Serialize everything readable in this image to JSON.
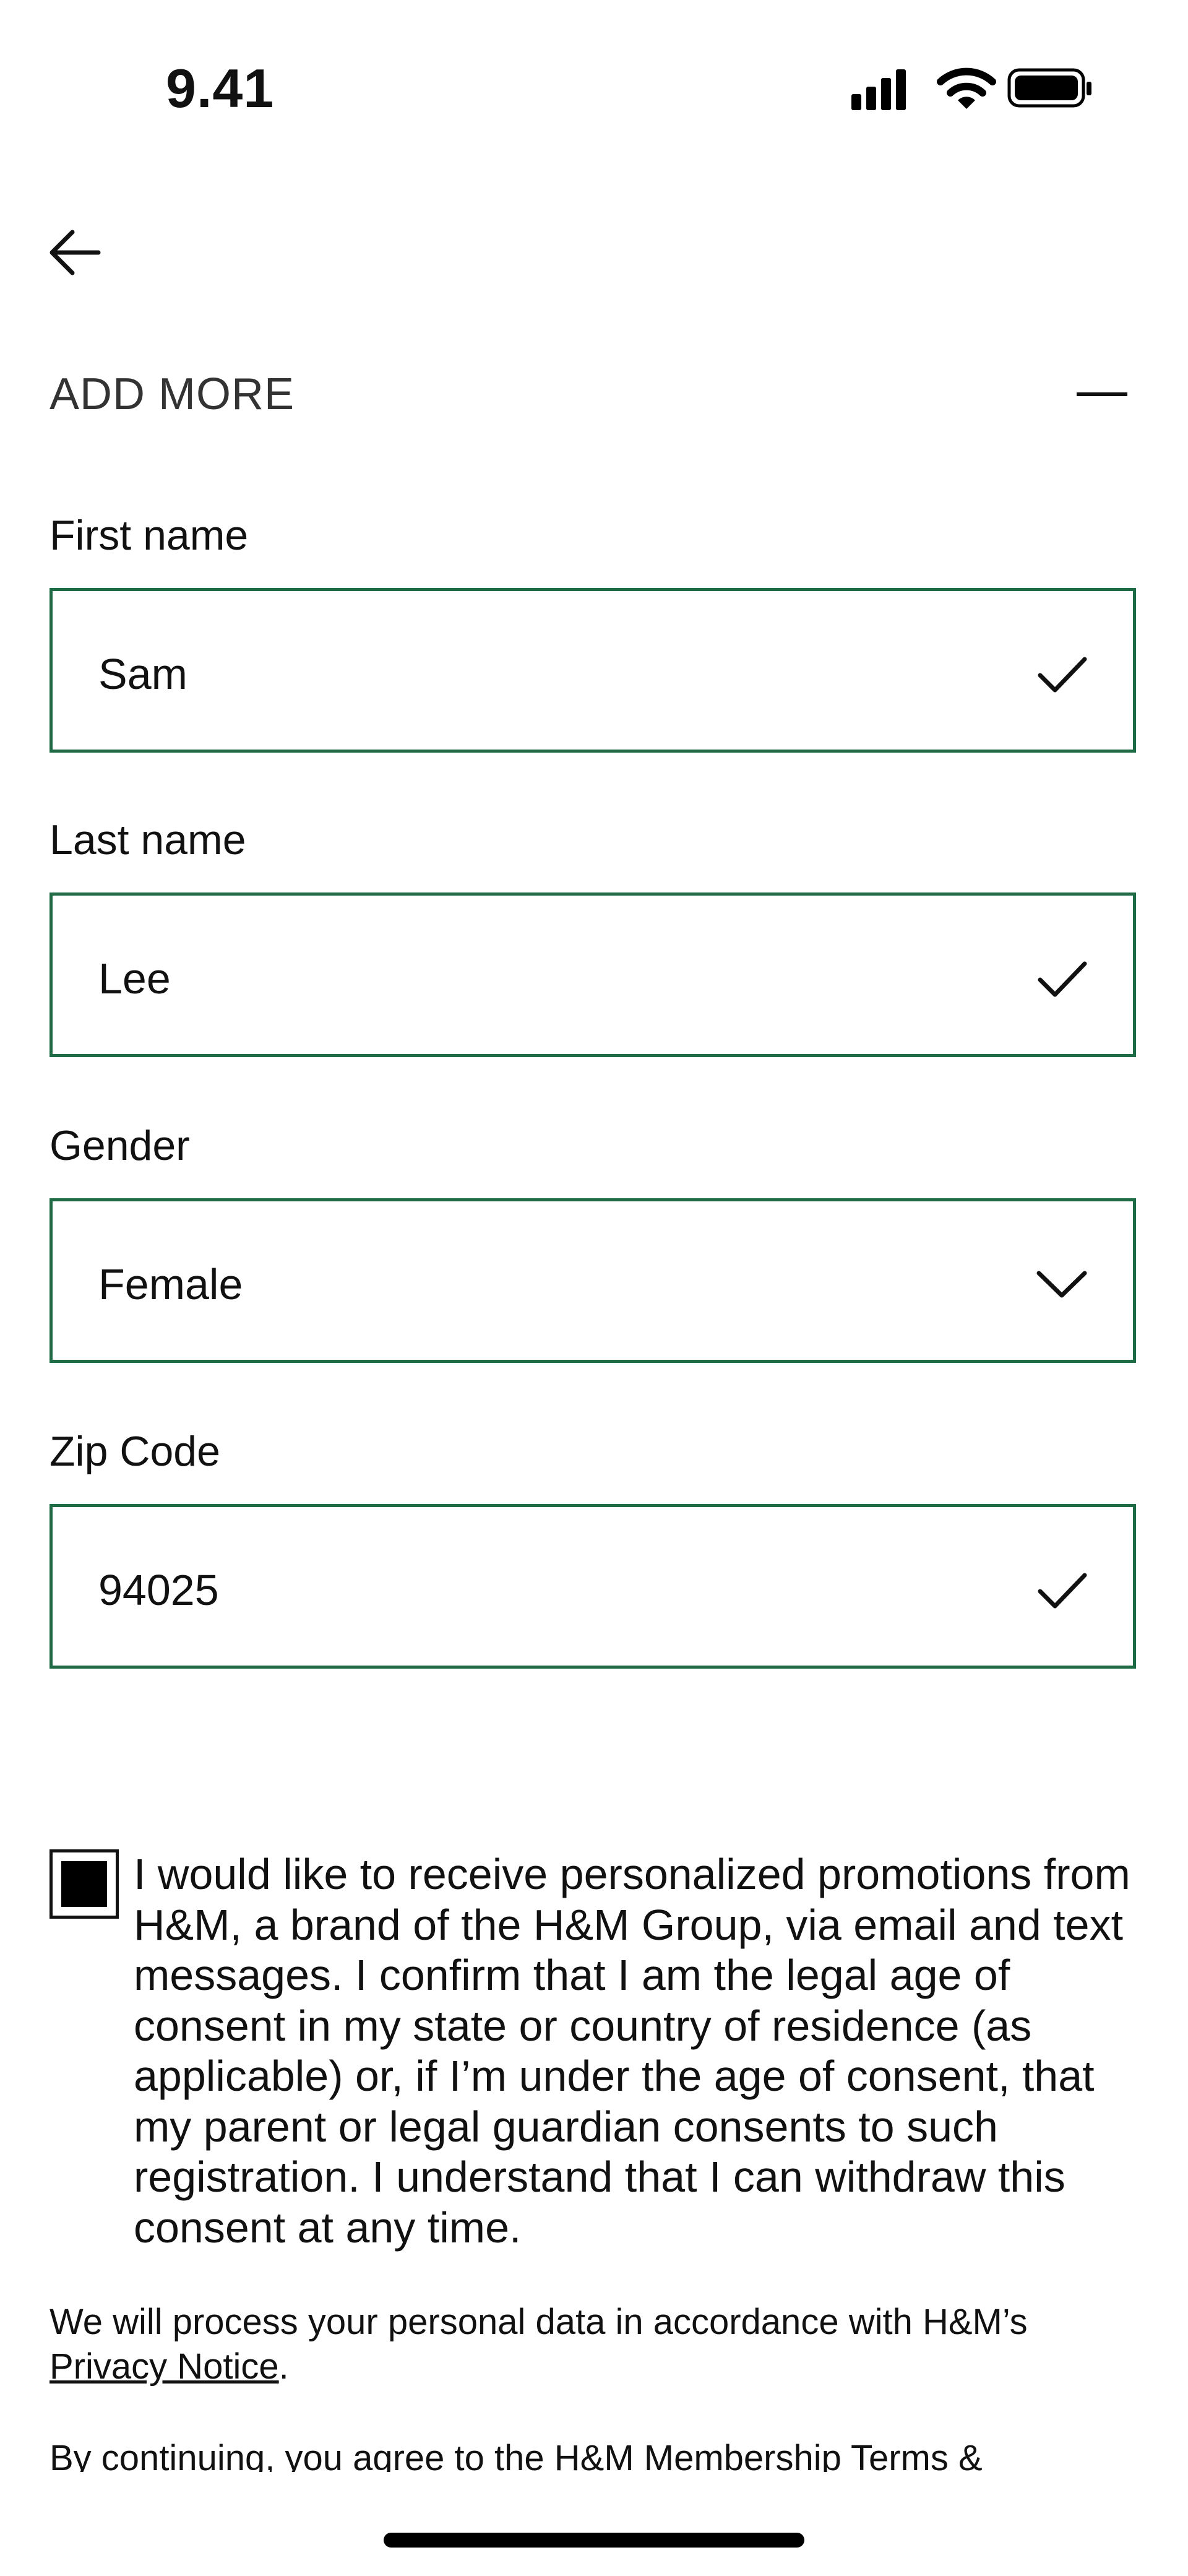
{
  "status_bar": {
    "time": "9.41",
    "icons": [
      "cellular-signal-icon",
      "wifi-icon",
      "battery-icon"
    ]
  },
  "nav": {
    "back_icon": "arrow-left-icon"
  },
  "section": {
    "title": "ADD MORE",
    "collapse_icon": "minus-icon"
  },
  "form": {
    "fields": [
      {
        "label": "First name",
        "value": "Sam",
        "icon": "checkmark-icon"
      },
      {
        "label": "Last name",
        "value": "Lee",
        "icon": "checkmark-icon"
      },
      {
        "label": "Gender",
        "value": "Female",
        "icon": "chevron-down-icon"
      },
      {
        "label": "Zip Code",
        "value": "94025",
        "icon": "checkmark-icon"
      }
    ]
  },
  "consent": {
    "checked": true,
    "text": "I would like to receive personalized promotions from H&M, a brand of the H&M Group, via email and text messages. I confirm that I am the legal age of consent in my state or country of residence (as applicable) or, if I’m under the age of consent, that my parent or legal guardian consents to such registration. I understand that I can withdraw this consent at any time."
  },
  "privacy": {
    "text": "We will process your personal data in accordance with H&M’s ",
    "link_label": "Privacy Notice",
    "suffix": "."
  },
  "terms": {
    "text": "By continuing, you agree to the H&M Membership Terms &"
  },
  "colors": {
    "field_border": "#1e6b45",
    "text": "#111111",
    "background": "#ffffff"
  }
}
